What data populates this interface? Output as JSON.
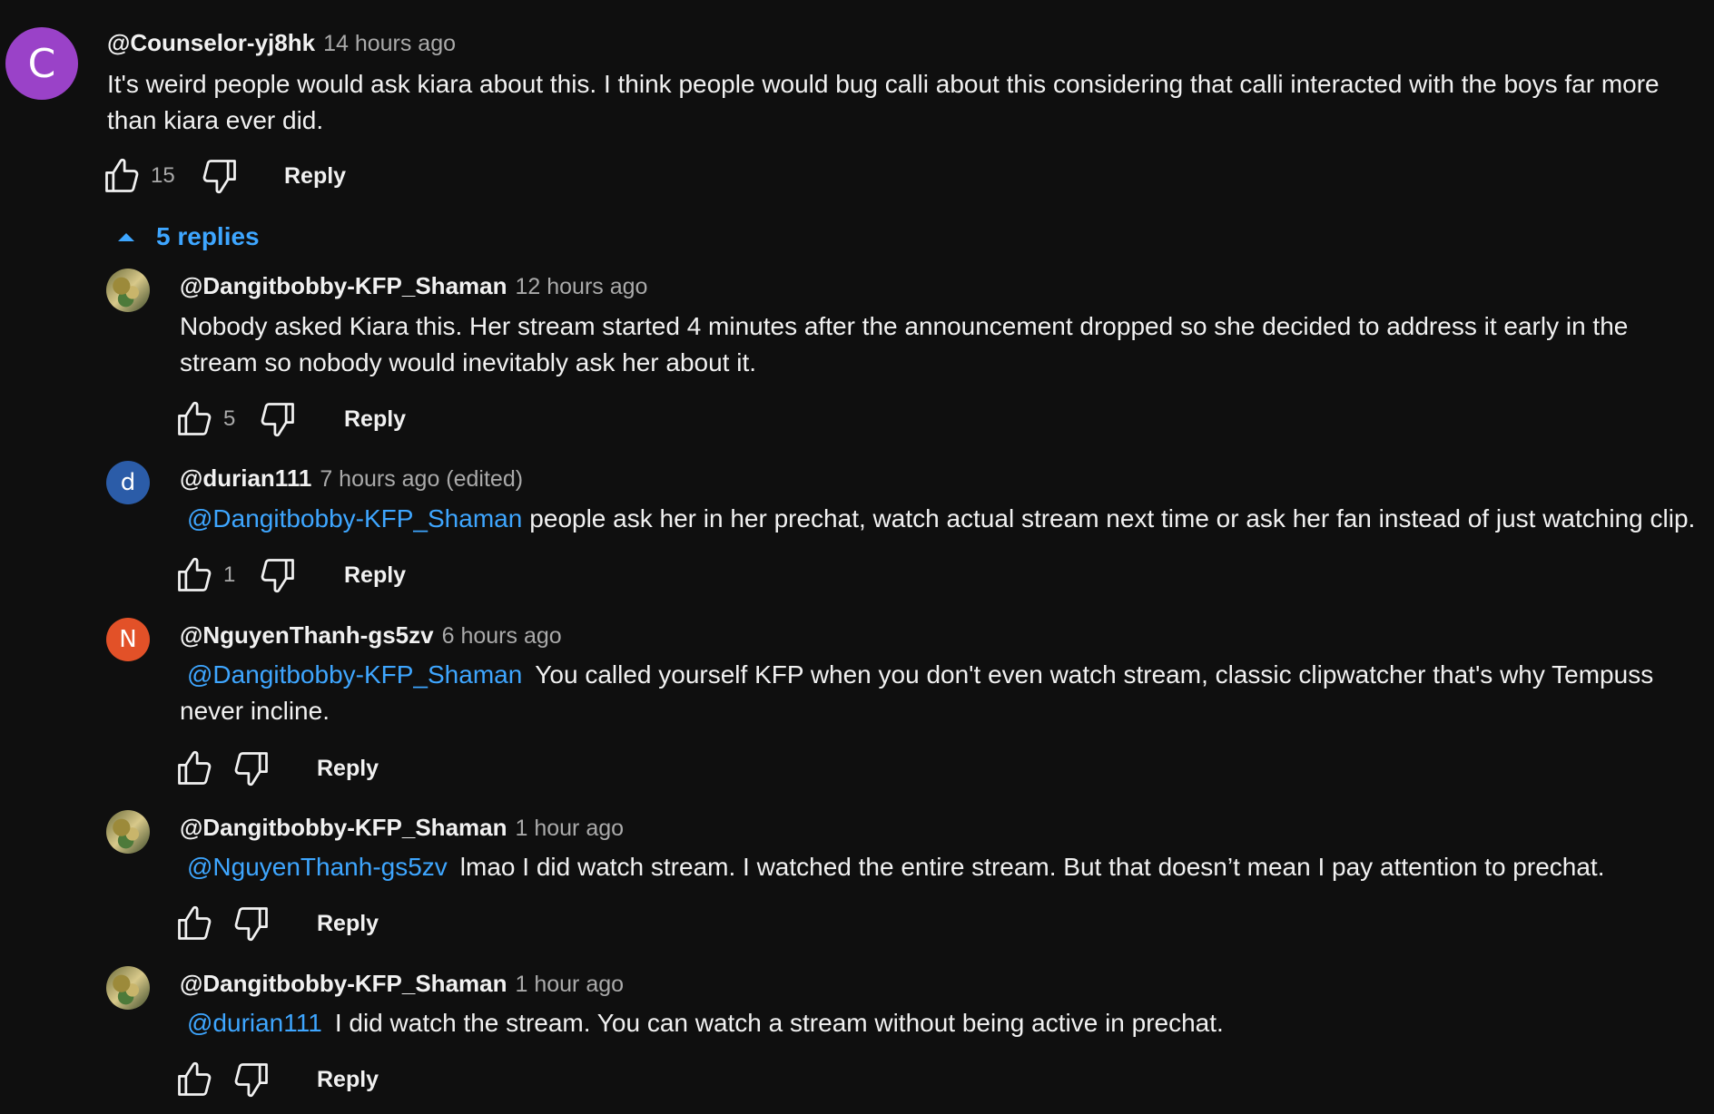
{
  "top_comment": {
    "avatar_letter": "C",
    "avatar_color": "#9a42c8",
    "author": "@Counselor-yj8hk",
    "time": "14 hours ago",
    "text": "It's weird people would ask kiara about this. I think people would bug calli about this considering that calli interacted with the boys far more than kiara ever did.",
    "likes": "15",
    "reply_label": "Reply"
  },
  "replies_toggle": {
    "label": "5 replies",
    "icon": "caret-up-icon"
  },
  "replies": [
    {
      "avatar_type": "image",
      "author": "@Dangitbobby-KFP_Shaman",
      "time": "12 hours ago",
      "mention": "",
      "text": "Nobody asked Kiara this. Her stream started 4 minutes after the announcement dropped so she decided to address it early in the stream so nobody would inevitably ask her about it.",
      "likes": "5",
      "reply_label": "Reply"
    },
    {
      "avatar_type": "letter",
      "avatar_letter": "d",
      "avatar_color": "#2b5ca8",
      "author": "@durian111",
      "time": "7 hours ago (edited)",
      "mention": "@Dangitbobby-KFP_Shaman",
      "text": "people ask her in her prechat, watch actual stream next time or ask her fan instead of just watching clip.",
      "likes": "1",
      "reply_label": "Reply"
    },
    {
      "avatar_type": "letter",
      "avatar_letter": "N",
      "avatar_color": "#e25128",
      "author": "@NguyenThanh-gs5zv",
      "time": "6 hours ago",
      "mention": "@Dangitbobby-KFP_Shaman",
      "text": "You called yourself KFP when you don't even watch stream, classic clipwatcher that's why Tempuss never incline.",
      "likes": "",
      "reply_label": "Reply"
    },
    {
      "avatar_type": "image",
      "author": "@Dangitbobby-KFP_Shaman",
      "time": "1 hour ago",
      "mention": "@NguyenThanh-gs5zv",
      "text": "lmao I did watch stream. I watched the entire stream. But that doesn’t mean I pay attention to prechat.",
      "likes": "",
      "reply_label": "Reply"
    },
    {
      "avatar_type": "image",
      "author": "@Dangitbobby-KFP_Shaman",
      "time": "1 hour ago",
      "mention": "@durian111",
      "text": "I did watch the stream. You can watch a stream without being active in prechat.",
      "likes": "",
      "reply_label": "Reply"
    }
  ],
  "icons": {
    "like": "thumbs-up-icon",
    "dislike": "thumbs-down-icon"
  }
}
